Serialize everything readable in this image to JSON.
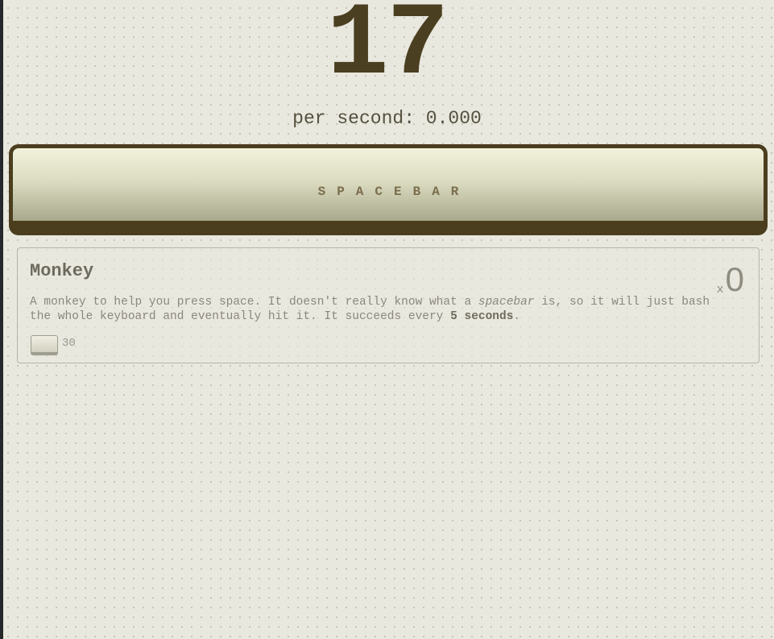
{
  "score": "17",
  "per_second_label": "per second: 0.000",
  "spacebar_label": "SPACEBAR",
  "upgrades": [
    {
      "name": "Monkey",
      "owned_prefix": "x",
      "owned": "0",
      "desc_part1": "A monkey to help you press space. It doesn't really know what a ",
      "desc_em": "spacebar",
      "desc_part2": " is, so it will just bash the whole keyboard and eventually hit it. It succeeds every ",
      "desc_bold": "5 seconds",
      "desc_end": ".",
      "cost": "30"
    }
  ]
}
